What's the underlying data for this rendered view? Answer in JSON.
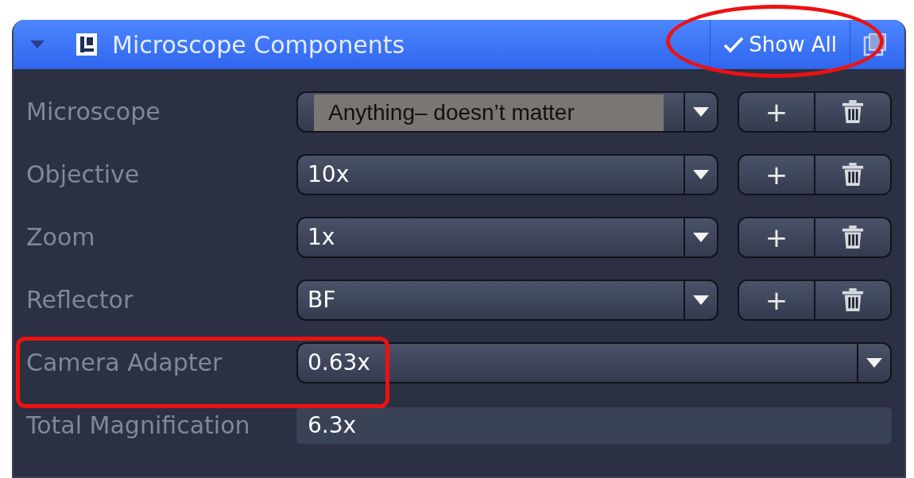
{
  "panel": {
    "title": "Microscope Components",
    "expanded": true,
    "show_all": {
      "label": "Show All",
      "checked": true
    }
  },
  "rows": [
    {
      "kind": "select_with_buttons",
      "label": "Microscope",
      "add": "+"
    },
    {
      "kind": "select_with_buttons",
      "label": "Objective",
      "value": "10x",
      "add": "+"
    },
    {
      "kind": "select_with_buttons",
      "label": "Zoom",
      "value": "1x",
      "add": "+"
    },
    {
      "kind": "select_with_buttons",
      "label": "Reflector",
      "value": "BF",
      "add": "+"
    },
    {
      "kind": "select",
      "label": "Camera Adapter",
      "value": "0.63x"
    },
    {
      "kind": "readout",
      "label": "Total Magnification",
      "value": "6.3x"
    }
  ],
  "annotation_note": "Anything– doesn’t matter"
}
